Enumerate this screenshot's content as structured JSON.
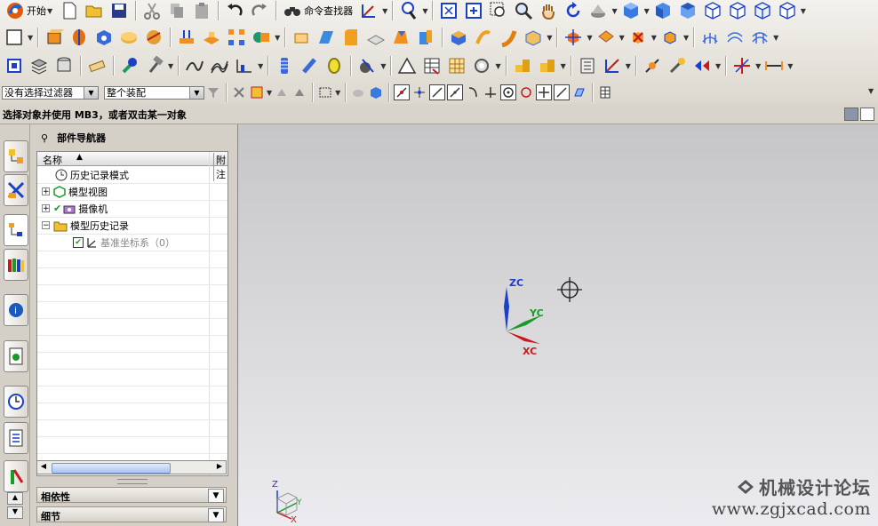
{
  "toolbar": {
    "start_label": "开始",
    "command_finder_label": "命令查找器"
  },
  "selection_bar": {
    "filter_value": "没有选择过滤器",
    "scope_value": "整个装配"
  },
  "status": {
    "prompt": "选择对象并使用 MB3，或者双击某一对象"
  },
  "navigator": {
    "title": "部件导航器",
    "columns": [
      "名称",
      "附注"
    ],
    "nodes": [
      {
        "label": "历史记录模式"
      },
      {
        "label": "模型视图"
      },
      {
        "label": "摄像机"
      },
      {
        "label": "模型历史记录"
      },
      {
        "label": "基准坐标系（0）"
      }
    ],
    "panels": [
      "相依性",
      "细节"
    ]
  },
  "graphics": {
    "triad": {
      "z": "ZC",
      "y": "YC",
      "x": "XC"
    },
    "view_triad": {
      "z": "Z",
      "y": "Y",
      "x": "X"
    }
  },
  "watermark": {
    "title": "机械设计论坛",
    "url": "www.zgjxcad.com"
  },
  "colors": {
    "graphics_top": "#c6c6c8",
    "graphics_bottom": "#ececf0",
    "z_axis": "#1a3fc8",
    "y_axis": "#1a9a2a",
    "x_axis": "#c81a1a"
  }
}
